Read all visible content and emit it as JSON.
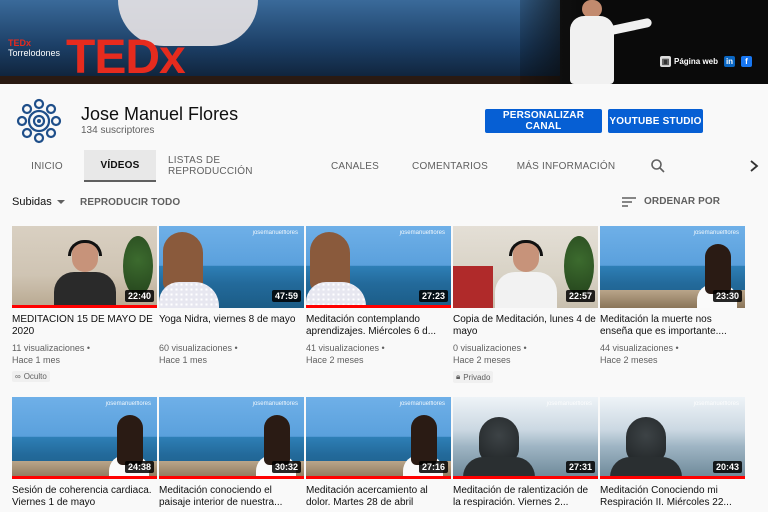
{
  "banner": {
    "tedx_label": "TEDx",
    "tedx_location": "Torrelodones",
    "tedx_big": "TEDx",
    "web_label": "Página web",
    "linkedin_label": "in",
    "facebook_label": "f"
  },
  "channel": {
    "name": "Jose Manuel Flores",
    "subscribers": "134 suscriptores",
    "customize_label": "PERSONALIZAR CANAL",
    "studio_label": "YOUTUBE STUDIO"
  },
  "tabs": [
    "INICIO",
    "VÍDEOS",
    "LISTAS DE REPRODUCCIÓN",
    "CANALES",
    "COMENTARIOS",
    "MÁS INFORMACIÓN"
  ],
  "active_tab": "VÍDEOS",
  "filter": {
    "sort_dropdown": "Subidas",
    "play_all": "REPRODUCIR TODO",
    "order_by": "ORDENAR POR"
  },
  "thumb_logo": "josemanuelflores",
  "videos": [
    {
      "title": "MEDITACIÓN 15 DE MAYO DE 2020",
      "duration": "22:40",
      "views": "11 visualizaciones",
      "age": "Hace 1 mes",
      "badge": "Oculto",
      "scene": "room",
      "progress": 1.0
    },
    {
      "title": "Yoga Nidra, viernes 8 de mayo",
      "duration": "47:59",
      "views": "60 visualizaciones",
      "age": "Hace 1 mes",
      "badge": "",
      "scene": "girl-left",
      "progress": 0.0
    },
    {
      "title": "Meditación contemplando aprendizajes. Miércoles 6 d...",
      "duration": "27:23",
      "views": "41 visualizaciones",
      "age": "Hace 2 meses",
      "badge": "",
      "scene": "girl-left",
      "progress": 1.0
    },
    {
      "title": "Copia de Meditación, lunes 4 de mayo",
      "duration": "22:57",
      "views": "0 visualizaciones",
      "age": "Hace 2 meses",
      "badge": "Privado",
      "scene": "room2",
      "progress": 0.0
    },
    {
      "title": "Meditación la muerte nos enseña que es importante....",
      "duration": "23:30",
      "views": "44 visualizaciones",
      "age": "Hace 2 meses",
      "badge": "",
      "scene": "girl-right",
      "progress": 0.0
    },
    {
      "title": "Sesión de coherencia cardiaca. Viernes 1 de mayo",
      "duration": "24:38",
      "views": "",
      "age": "",
      "badge": "",
      "scene": "girl-right",
      "progress": 1.0
    },
    {
      "title": "Meditación conociendo el paisaje interior de nuestra...",
      "duration": "30:32",
      "views": "",
      "age": "",
      "badge": "",
      "scene": "girl-right",
      "progress": 1.0
    },
    {
      "title": "Meditación acercamiento al dolor. Martes 28 de abril",
      "duration": "27:16",
      "views": "",
      "age": "",
      "badge": "",
      "scene": "girl-right",
      "progress": 1.0
    },
    {
      "title": "Meditación de ralentización de la respiración. Viernes 2...",
      "duration": "27:31",
      "views": "",
      "age": "",
      "badge": "",
      "scene": "misty",
      "progress": 1.0
    },
    {
      "title": "Meditación Conociendo mi Respiración II. Miércoles 22...",
      "duration": "20:43",
      "views": "",
      "age": "",
      "badge": "",
      "scene": "misty",
      "progress": 1.0
    }
  ],
  "colors": {
    "accent": "#065fd4",
    "progress": "#ff0000",
    "tedx_red": "#e62b1e"
  }
}
